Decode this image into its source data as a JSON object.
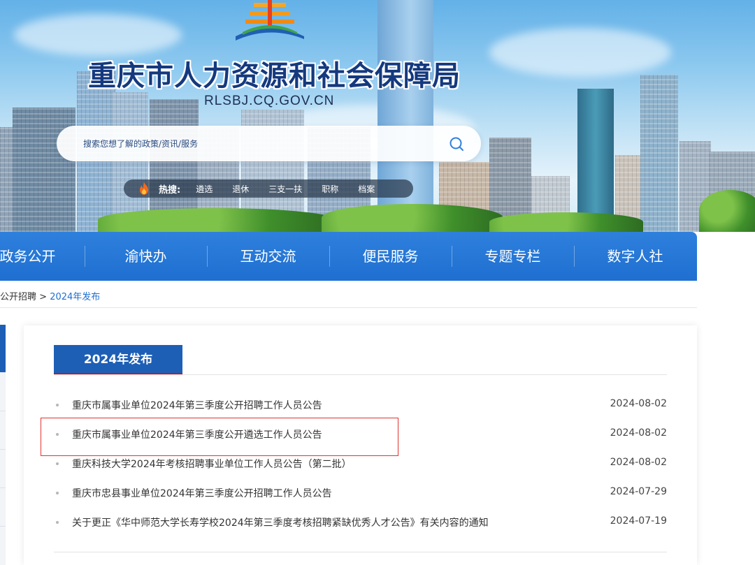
{
  "site": {
    "title": "重庆市人力资源和社会保障局",
    "domain": "RLSBJ.CQ.GOV.CN"
  },
  "search": {
    "placeholder": "搜索您想了解的政策/资讯/服务"
  },
  "hot": {
    "label": "热搜:",
    "items": [
      "遴选",
      "退休",
      "三支一扶",
      "职称",
      "档案"
    ]
  },
  "nav": {
    "items": [
      "政务公开",
      "渝快办",
      "互动交流",
      "便民服务",
      "专题专栏",
      "数字人社"
    ]
  },
  "breadcrumb": {
    "parent": "公开招聘",
    "separator": " > ",
    "current": "2024年发布"
  },
  "content": {
    "tab_label": "2024年发布",
    "rows": [
      {
        "title": "重庆市属事业单位2024年第三季度公开招聘工作人员公告",
        "date": "2024-08-02"
      },
      {
        "title": "重庆市属事业单位2024年第三季度公开遴选工作人员公告",
        "date": "2024-08-02"
      },
      {
        "title": "重庆科技大学2024年考核招聘事业单位工作人员公告（第二批）",
        "date": "2024-08-02"
      },
      {
        "title": "重庆市忠县事业单位2024年第三季度公开招聘工作人员公告",
        "date": "2024-07-29"
      },
      {
        "title": "关于更正《华中师范大学长寿学校2024年第三季度考核招聘紧缺优秀人才公告》有关内容的通知",
        "date": "2024-07-19"
      }
    ]
  },
  "colors": {
    "nav_blue": "#1e6fd0",
    "title_navy": "#14397e",
    "tab_blue": "#1e5fb6",
    "highlight_red": "#e0332f"
  }
}
